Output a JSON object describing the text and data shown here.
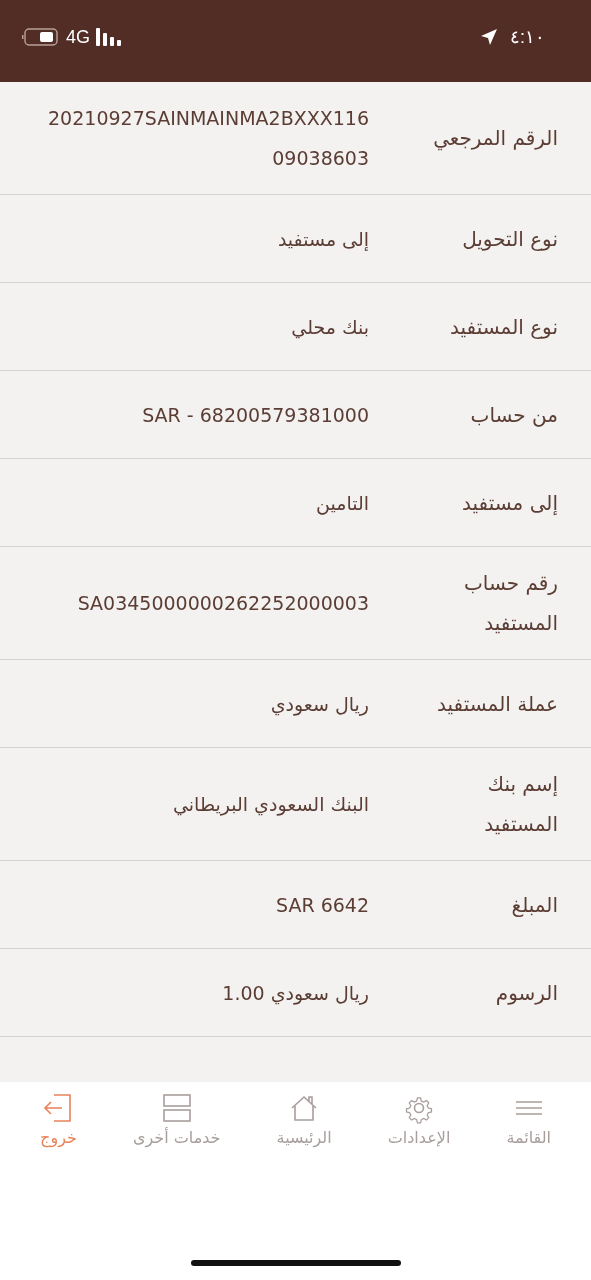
{
  "status_bar": {
    "time": "٤:١٠",
    "network": "4G"
  },
  "details": [
    {
      "label": "الرقم المرجعي",
      "value": "20210927SAINMAINMA2BXXX11609038603"
    },
    {
      "label": "نوع التحويل",
      "value": "إلى مستفيد"
    },
    {
      "label": "نوع المستفيد",
      "value": "بنك محلي"
    },
    {
      "label": "من حساب",
      "value": "SAR - 68200579381000"
    },
    {
      "label": "إلى مستفيد",
      "value": "التامين"
    },
    {
      "label": "رقم حساب المستفيد",
      "value": "SA0345000000262252000003"
    },
    {
      "label": "عملة المستفيد",
      "value": "ريال سعودي"
    },
    {
      "label": "إسم بنك المستفيد",
      "value": "البنك السعودي البريطاني"
    },
    {
      "label": "المبلغ",
      "value": "SAR 6642"
    },
    {
      "label": "الرسوم",
      "value": "1.00 ريال سعودي"
    }
  ],
  "nav": [
    {
      "kind": "menu",
      "label": "القائمة",
      "color": "#a89e9b"
    },
    {
      "kind": "settings",
      "label": "الإعدادات",
      "color": "#a89e9b"
    },
    {
      "kind": "home",
      "label": "الرئيسية",
      "color": "#a89e9b"
    },
    {
      "kind": "services",
      "label": "خدمات أخرى",
      "color": "#a89e9b"
    },
    {
      "kind": "logout",
      "label": "خروج",
      "color": "#e8835a"
    }
  ]
}
